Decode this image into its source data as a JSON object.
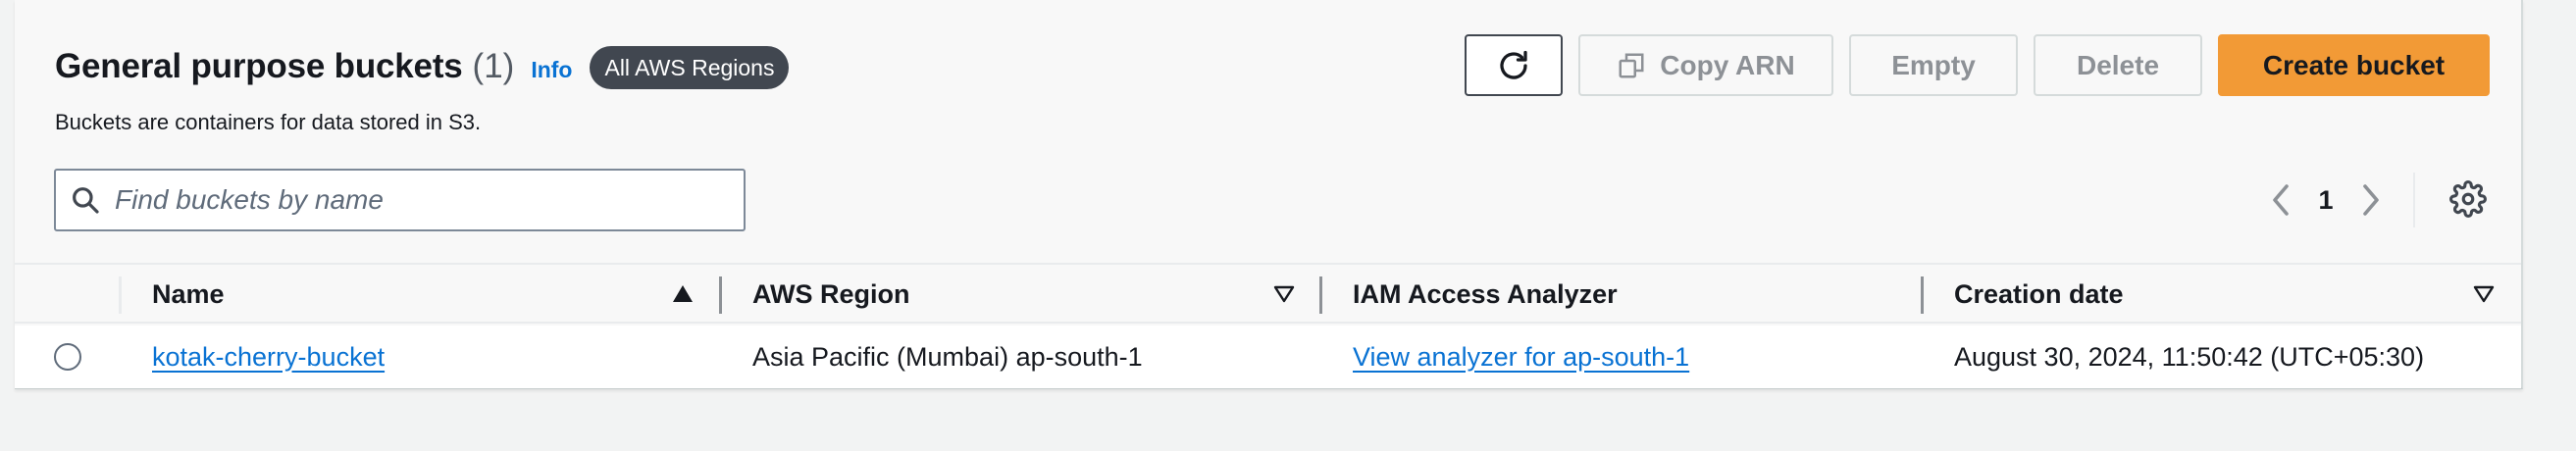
{
  "header": {
    "title": "General purpose buckets",
    "count": "(1)",
    "info_link": "Info",
    "region_badge": "All AWS Regions",
    "subtitle": "Buckets are containers for data stored in S3."
  },
  "toolbar": {
    "refresh_icon": "refresh-icon",
    "copy_arn_label": "Copy ARN",
    "empty_label": "Empty",
    "delete_label": "Delete",
    "create_bucket_label": "Create bucket",
    "create_bucket_color": "#f29a36"
  },
  "search": {
    "placeholder": "Find buckets by name",
    "value": ""
  },
  "pagination": {
    "current_page": "1"
  },
  "table": {
    "columns": [
      {
        "label": "Name",
        "sort": "ascending"
      },
      {
        "label": "AWS Region",
        "sort": "none"
      },
      {
        "label": "IAM Access Analyzer",
        "sort": ""
      },
      {
        "label": "Creation date",
        "sort": "none"
      }
    ],
    "rows": [
      {
        "selected": false,
        "name": "kotak-cherry-bucket",
        "region": "Asia Pacific (Mumbai) ap-south-1",
        "access_analyzer": "View analyzer for ap-south-1",
        "creation_date": "August 30, 2024, 11:50:42 (UTC+05:30)"
      }
    ]
  },
  "colors": {
    "link": "#0972d3",
    "badge_bg": "#414750",
    "primary_button": "#f29a36"
  }
}
